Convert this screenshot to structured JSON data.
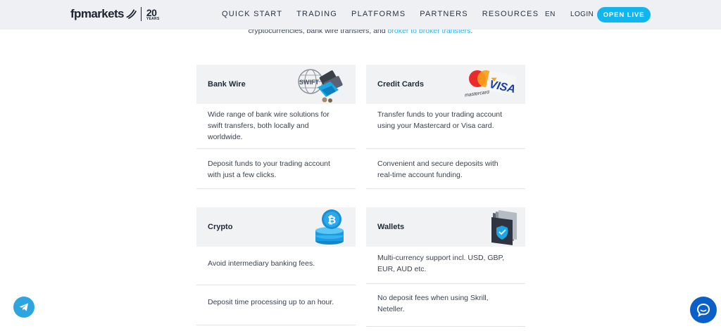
{
  "header": {
    "logo_text": "fpmarkets",
    "logo_years_num": "20",
    "logo_years_txt": "YEARS",
    "nav": [
      "QUICK START",
      "TRADING",
      "PLATFORMS",
      "PARTNERS",
      "RESOURCES"
    ],
    "lang": "EN",
    "login": "LOGIN",
    "open_live": "OPEN LIVE"
  },
  "intro": {
    "text": "cryptocurrencies, bank wire transfers, and ",
    "link": "broker to broker transfers",
    "end": "."
  },
  "cards": [
    {
      "title": "Bank Wire",
      "icon": "swift-globe-icon",
      "rows": [
        [
          "Wide range of bank wire solutions for",
          "swift transfers, both locally and",
          "worldwide."
        ],
        [
          "Deposit funds to your trading account",
          "with just a few clicks."
        ]
      ]
    },
    {
      "title": "Credit Cards",
      "icon": "mastercard-visa-icon",
      "rows": [
        [
          "Transfer funds to your trading account",
          "using your Mastercard or Visa card."
        ],
        [
          "Convenient and secure deposits with",
          "real-time account funding."
        ]
      ]
    },
    {
      "title": "Crypto",
      "icon": "bitcoin-coins-icon",
      "rows": [
        [
          "Avoid intermediary banking fees."
        ],
        [
          "Deposit time processing up to an hour."
        ]
      ]
    },
    {
      "title": "Wallets",
      "icon": "secure-wallet-icon",
      "rows": [
        [
          "Multi-currency support incl. USD, GBP,",
          "EUR, AUD etc."
        ],
        [
          "No deposit fees when using Skrill,",
          "Neteller."
        ]
      ]
    }
  ],
  "icon_labels": {
    "swift": "SWIFT",
    "mastercard": "mastercard",
    "visa": "VISA"
  },
  "colors": {
    "accent": "#12b6ee",
    "header_bg": "#eef0f3",
    "card_head_bg": "#f1f2f4",
    "chat": "#0a5fc9",
    "telegram": "#2ca5e0"
  }
}
